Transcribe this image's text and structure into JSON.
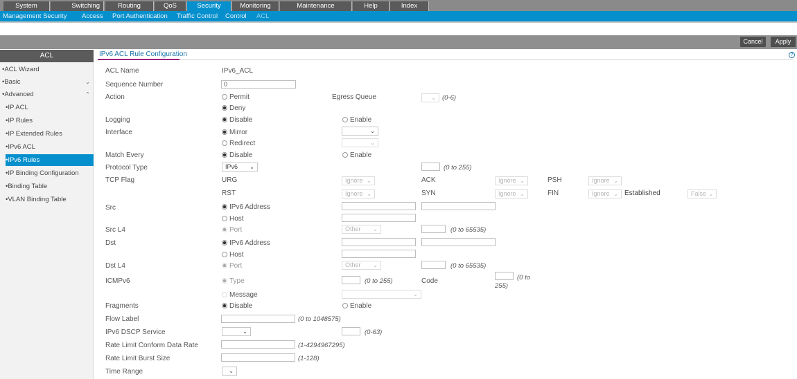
{
  "nav": {
    "tabs": [
      "System",
      "Switching",
      "Routing",
      "QoS",
      "Security",
      "Monitoring",
      "Maintenance",
      "Help",
      "Index"
    ],
    "active_tab": "Security",
    "subnav": [
      "Management Security",
      "Access",
      "Port Authentication",
      "Traffic Control",
      "Control",
      "ACL"
    ],
    "active_sub": "ACL"
  },
  "buttons": {
    "cancel": "Cancel",
    "apply": "Apply"
  },
  "sidebar": {
    "header": "ACL",
    "items": [
      {
        "label": "•ACL Wizard"
      },
      {
        "label": "•Basic"
      },
      {
        "label": "•Advanced"
      },
      {
        "label": "•IP ACL"
      },
      {
        "label": "•IP Rules"
      },
      {
        "label": "•IP Extended Rules"
      },
      {
        "label": "•IPv6 ACL"
      },
      {
        "label": "•IPv6 Rules"
      },
      {
        "label": "•IP Binding Configuration"
      },
      {
        "label": "•Binding Table"
      },
      {
        "label": "•VLAN Binding Table"
      }
    ],
    "chevrons": {
      "basic": "⌄",
      "advanced": "⌃"
    }
  },
  "page": {
    "title": "IPv6 ACL Rule Configuration",
    "help": "?"
  },
  "form": {
    "acl_name": {
      "label": "ACL Name",
      "value": "IPv6_ACL"
    },
    "sequence_number": {
      "label": "Sequence Number",
      "value": "0"
    },
    "action": {
      "label": "Action",
      "permit": "Permit",
      "deny": "Deny"
    },
    "egress_queue": {
      "label": "Egress Queue",
      "range": "(0-6)"
    },
    "logging": {
      "label": "Logging",
      "disable": "Disable",
      "enable": "Enable"
    },
    "interface": {
      "label": "Interface",
      "mirror": "Mirror",
      "redirect": "Redirect"
    },
    "match_every": {
      "label": "Match Every",
      "disable": "Disable",
      "enable": "Enable"
    },
    "protocol_type": {
      "label": "Protocol Type",
      "value": "IPv6",
      "range": "(0 to 255)"
    },
    "tcp_flag": {
      "label": "TCP Flag",
      "urg": "URG",
      "ack": "ACK",
      "psh": "PSH",
      "rst": "RST",
      "syn": "SYN",
      "fin": "FIN",
      "ignore": "Ignore",
      "established": "Established",
      "established_value": "False"
    },
    "src": {
      "label": "Src",
      "ipv6": "IPv6 Address",
      "host": "Host"
    },
    "src_l4": {
      "label": "Src L4",
      "port": "Port",
      "other": "Other",
      "range": "(0 to 65535)"
    },
    "dst": {
      "label": "Dst",
      "ipv6": "IPv6 Address",
      "host": "Host"
    },
    "dst_l4": {
      "label": "Dst L4",
      "port": "Port",
      "other": "Other",
      "range": "(0 to 65535)"
    },
    "icmpv6": {
      "label": "ICMPv6",
      "type": "Type",
      "type_range": "(0 to 255)",
      "code": "Code",
      "code_range_1": "(0 to",
      "code_range_2": "255)",
      "message": "Message"
    },
    "fragments": {
      "label": "Fragments",
      "disable": "Disable",
      "enable": "Enable"
    },
    "flow_label": {
      "label": "Flow Label",
      "range": "(0 to 1048575)"
    },
    "dscp": {
      "label": "IPv6 DSCP Service",
      "range": "(0-63)"
    },
    "rate_conform": {
      "label": "Rate Limit Conform Data Rate",
      "range": "(1-4294967295)"
    },
    "rate_burst": {
      "label": "Rate Limit Burst Size",
      "range": "(1-128)"
    },
    "time_range": {
      "label": "Time Range"
    }
  }
}
